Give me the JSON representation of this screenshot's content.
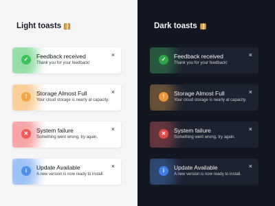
{
  "light": {
    "heading": "Light toasts",
    "toasts": [
      {
        "title": "Feedback received",
        "message": "Thank you for your feedback!",
        "icon": "check-icon",
        "close": "×"
      },
      {
        "title": "Storage Almost Full",
        "message": "Your cloud storage is nearly at capacity.",
        "icon": "exclamation-icon",
        "close": "×"
      },
      {
        "title": "System failure",
        "message": "Something went wrong, try again.",
        "icon": "x-icon",
        "close": "×"
      },
      {
        "title": "Update Available",
        "message": "A new version is now ready to install.",
        "icon": "info-icon",
        "close": "×"
      }
    ]
  },
  "dark": {
    "heading": "Dark toasts",
    "toasts": [
      {
        "title": "Feedback received",
        "message": "Thank you for your feedback!",
        "icon": "check-icon",
        "close": "×"
      },
      {
        "title": "Storage Almost Full",
        "message": "Your cloud storage is nearly at capacity.",
        "icon": "exclamation-icon",
        "close": "×"
      },
      {
        "title": "System failure",
        "message": "Something went wrong, try again.",
        "icon": "x-icon",
        "close": "×"
      },
      {
        "title": "Update Available",
        "message": "A new version is now ready to install.",
        "icon": "info-icon",
        "close": "×"
      }
    ]
  },
  "icons": {
    "success": "✓",
    "warning": "!",
    "error": "✕",
    "info": "i"
  },
  "colors": {
    "light_bg": "#f5f5f7",
    "dark_bg": "#131722",
    "success": "#3ec25c",
    "warning": "#f2a646",
    "error": "#ee5a5a",
    "info": "#4f8ff0"
  }
}
